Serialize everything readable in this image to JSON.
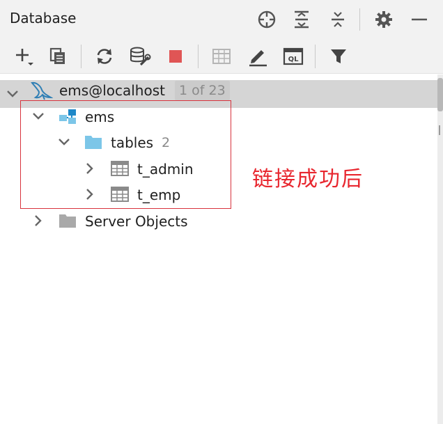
{
  "panel": {
    "title": "Database"
  },
  "header_icons": [
    "crosshair-icon",
    "expand-all-icon",
    "collapse-all-icon",
    "gear-icon",
    "minimize-icon"
  ],
  "toolbar_icons": [
    "add-icon",
    "copy-icon",
    "refresh-icon",
    "schema-settings-icon",
    "stop-icon",
    "table-view-icon",
    "edit-icon",
    "ql-console-icon",
    "filter-icon"
  ],
  "tree": {
    "connection": {
      "label": "ems@localhost",
      "badge": "1 of 23"
    },
    "schema": {
      "label": "ems"
    },
    "tables": {
      "label": "tables",
      "count": "2"
    },
    "table_items": [
      {
        "label": "t_admin"
      },
      {
        "label": "t_emp"
      }
    ],
    "server_objects": {
      "label": "Server Objects"
    }
  },
  "annotation": {
    "text": "链接成功后"
  },
  "colors": {
    "accent_blue": "#1e88c8",
    "folder_blue": "#7cc6e8",
    "stop_red": "#e05555",
    "annotation_red": "#e8262e"
  }
}
